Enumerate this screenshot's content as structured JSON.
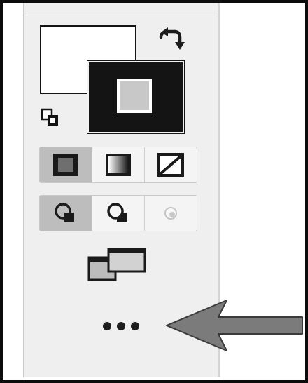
{
  "toolbar": {
    "swap_icon": "swap-arrow-icon",
    "default_colors_icon": "default-colors-icon",
    "fill_modes": [
      {
        "icon": "solid-color-icon",
        "active": true
      },
      {
        "icon": "gradient-icon",
        "active": false
      },
      {
        "icon": "none-icon",
        "active": false
      }
    ],
    "draw_modes": [
      {
        "icon": "draw-normal-icon",
        "active": true
      },
      {
        "icon": "draw-behind-icon",
        "active": false
      },
      {
        "icon": "draw-inside-icon",
        "active": false
      }
    ],
    "screen_mode_icon": "screen-mode-icon",
    "more_icon": "more-icon"
  },
  "annotation": {
    "arrow_color": "#7b7b7b"
  },
  "colors": {
    "panel": "#efefef",
    "stroke": "#141414",
    "active_segment": "#bdbdbd"
  }
}
